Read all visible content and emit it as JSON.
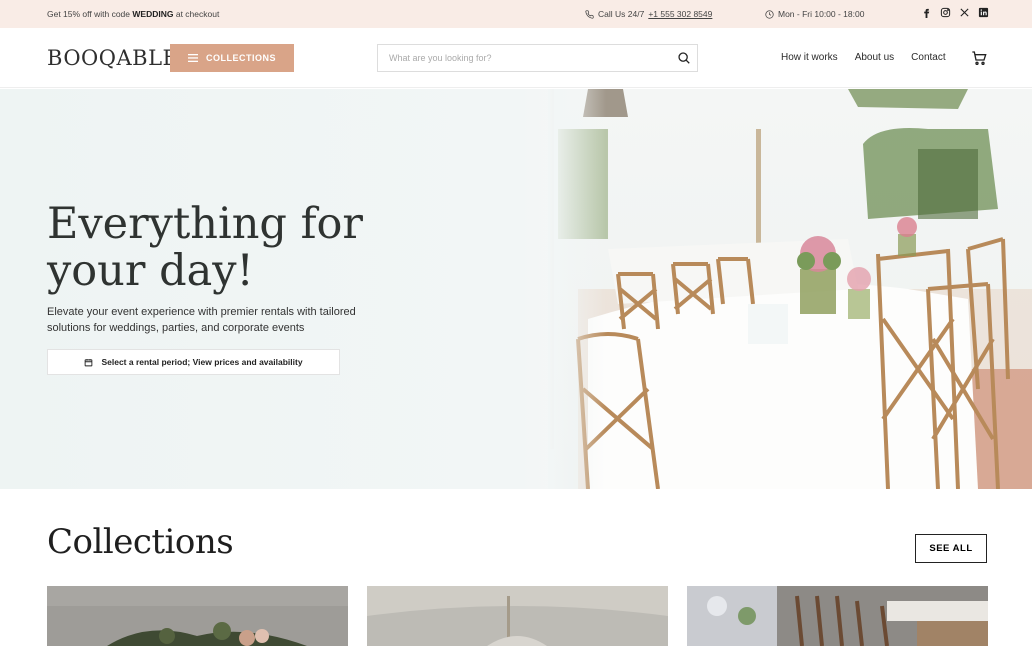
{
  "topbar": {
    "promo_prefix": "Get 15% off with code",
    "promo_code": "WEDDING",
    "promo_suffix": "at checkout",
    "phone_label": "Call Us 24/7",
    "phone_number": "+1 555 302 8549",
    "hours": "Mon - Fri 10:00 - 18:00",
    "social": [
      "facebook-icon",
      "instagram-icon",
      "x-icon",
      "linkedin-icon"
    ]
  },
  "header": {
    "logo": "BOOQABLE",
    "collections_label": "COLLECTIONS",
    "search_placeholder": "What are you looking for?",
    "nav": [
      "How it works",
      "About us",
      "Contact"
    ]
  },
  "hero": {
    "title_line1": "Everything for",
    "title_line2": "your day!",
    "subtitle": "Elevate your event experience with premier rentals with tailored solutions for weddings, parties, and corporate events",
    "rental_button": "Select a rental period; View prices and availability"
  },
  "collections": {
    "title": "Collections",
    "see_all": "SEE ALL"
  },
  "colors": {
    "accent": "#d9a488",
    "topbar_bg": "#f9ece6",
    "text": "#2b2b2b"
  }
}
